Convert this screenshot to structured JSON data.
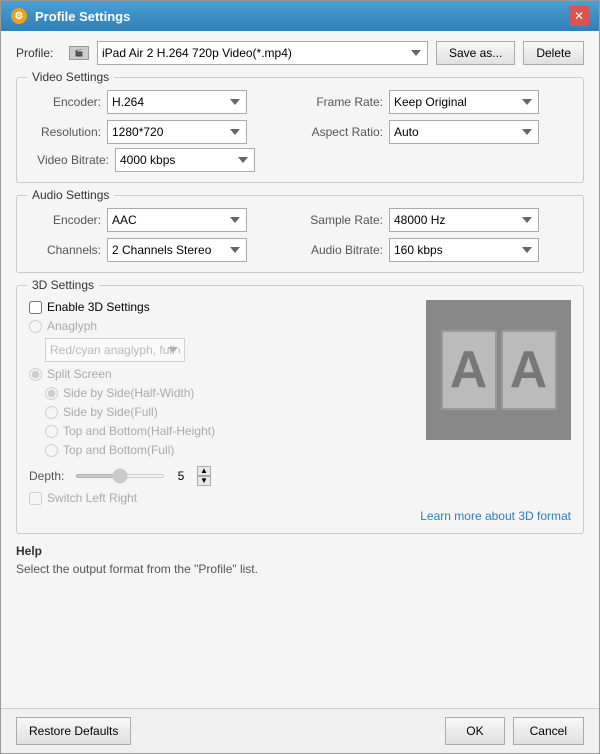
{
  "window": {
    "title": "Profile Settings",
    "icon": "gear"
  },
  "profile": {
    "label": "Profile:",
    "value": "iPad Air 2 H.264 720p Video(*.mp4)",
    "save_as_label": "Save as...",
    "delete_label": "Delete"
  },
  "video_settings": {
    "legend": "Video Settings",
    "encoder_label": "Encoder:",
    "encoder_value": "H.264",
    "frame_rate_label": "Frame Rate:",
    "frame_rate_value": "Keep Original",
    "resolution_label": "Resolution:",
    "resolution_value": "1280*720",
    "aspect_ratio_label": "Aspect Ratio:",
    "aspect_ratio_value": "Auto",
    "video_bitrate_label": "Video Bitrate:",
    "video_bitrate_value": "4000 kbps"
  },
  "audio_settings": {
    "legend": "Audio Settings",
    "encoder_label": "Encoder:",
    "encoder_value": "AAC",
    "sample_rate_label": "Sample Rate:",
    "sample_rate_value": "48000 Hz",
    "channels_label": "Channels:",
    "channels_value": "2 Channels Stereo",
    "audio_bitrate_label": "Audio Bitrate:",
    "audio_bitrate_value": "160 kbps"
  },
  "settings_3d": {
    "legend": "3D Settings",
    "enable_label": "Enable 3D Settings",
    "anaglyph_label": "Anaglyph",
    "anaglyph_value": "Red/cyan anaglyph, full color",
    "split_screen_label": "Split Screen",
    "side_by_side_half_label": "Side by Side(Half-Width)",
    "side_by_side_full_label": "Side by Side(Full)",
    "top_bottom_half_label": "Top and Bottom(Half-Height)",
    "top_bottom_full_label": "Top and Bottom(Full)",
    "depth_label": "Depth:",
    "depth_value": "5",
    "switch_label": "Switch Left Right",
    "learn_more_label": "Learn more about 3D format",
    "preview_left": "A",
    "preview_right": "A"
  },
  "help": {
    "title": "Help",
    "text": "Select the output format from the \"Profile\" list."
  },
  "footer": {
    "restore_label": "Restore Defaults",
    "ok_label": "OK",
    "cancel_label": "Cancel"
  }
}
